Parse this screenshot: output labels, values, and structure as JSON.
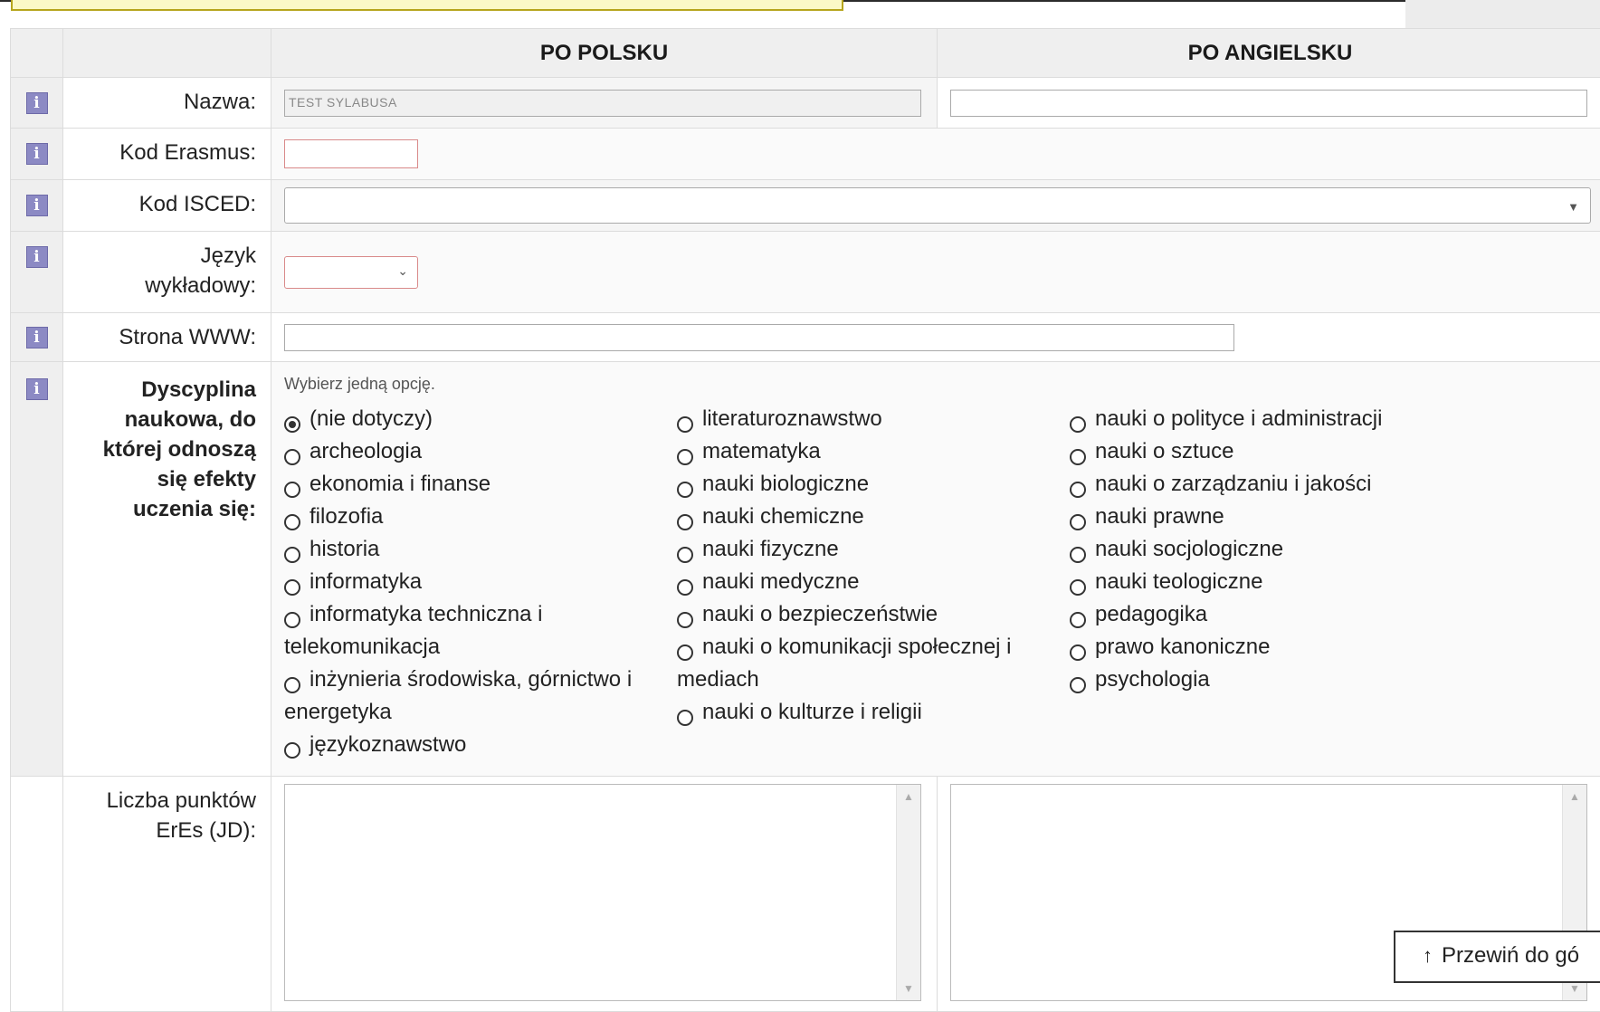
{
  "header": {
    "col_pl": "PO POLSKU",
    "col_en": "PO ANGIELSKU"
  },
  "fields": {
    "nazwa": {
      "label": "Nazwa:",
      "value_pl": "TEST SYLABUSA",
      "value_en": ""
    },
    "erasmus": {
      "label": "Kod Erasmus:",
      "value": ""
    },
    "isced": {
      "label": "Kod ISCED:",
      "value": ""
    },
    "jezyk": {
      "label_line1": "Język",
      "label_line2": "wykładowy:",
      "value": ""
    },
    "www": {
      "label": "Strona WWW:",
      "value": ""
    },
    "dyscyplina": {
      "label_line1": "Dyscyplina",
      "label_line2": "naukowa, do",
      "label_line3": "której odnoszą",
      "label_line4": "się efekty",
      "label_line5": "uczenia się:",
      "hint": "Wybierz jedną opcję.",
      "selected": "(nie dotyczy)",
      "col1": [
        "(nie dotyczy)",
        "archeologia",
        "ekonomia i finanse",
        "filozofia",
        "historia",
        "informatyka",
        "informatyka techniczna i telekomunikacja",
        "inżynieria środowiska, górnictwo i energetyka",
        "językoznawstwo"
      ],
      "col2": [
        "literaturoznawstwo",
        "matematyka",
        "nauki biologiczne",
        "nauki chemiczne",
        "nauki fizyczne",
        "nauki medyczne",
        "nauki o bezpieczeństwie",
        "nauki o komunikacji społecznej i mediach",
        "nauki o kulturze i religii"
      ],
      "col3": [
        "nauki o polityce i administracji",
        "nauki o sztuce",
        "nauki o zarządzaniu i jakości",
        "nauki prawne",
        "nauki socjologiczne",
        "nauki teologiczne",
        "pedagogika",
        "prawo kanoniczne",
        "psychologia"
      ]
    },
    "ects": {
      "label_line1": "Liczba punktów",
      "label_line2": "ErEs (JD):",
      "value_pl": "",
      "value_en": ""
    }
  },
  "scroll_top": {
    "label": "Przewiń do gó",
    "icon": "arrow-up-icon"
  },
  "icons": {
    "info": "i"
  }
}
